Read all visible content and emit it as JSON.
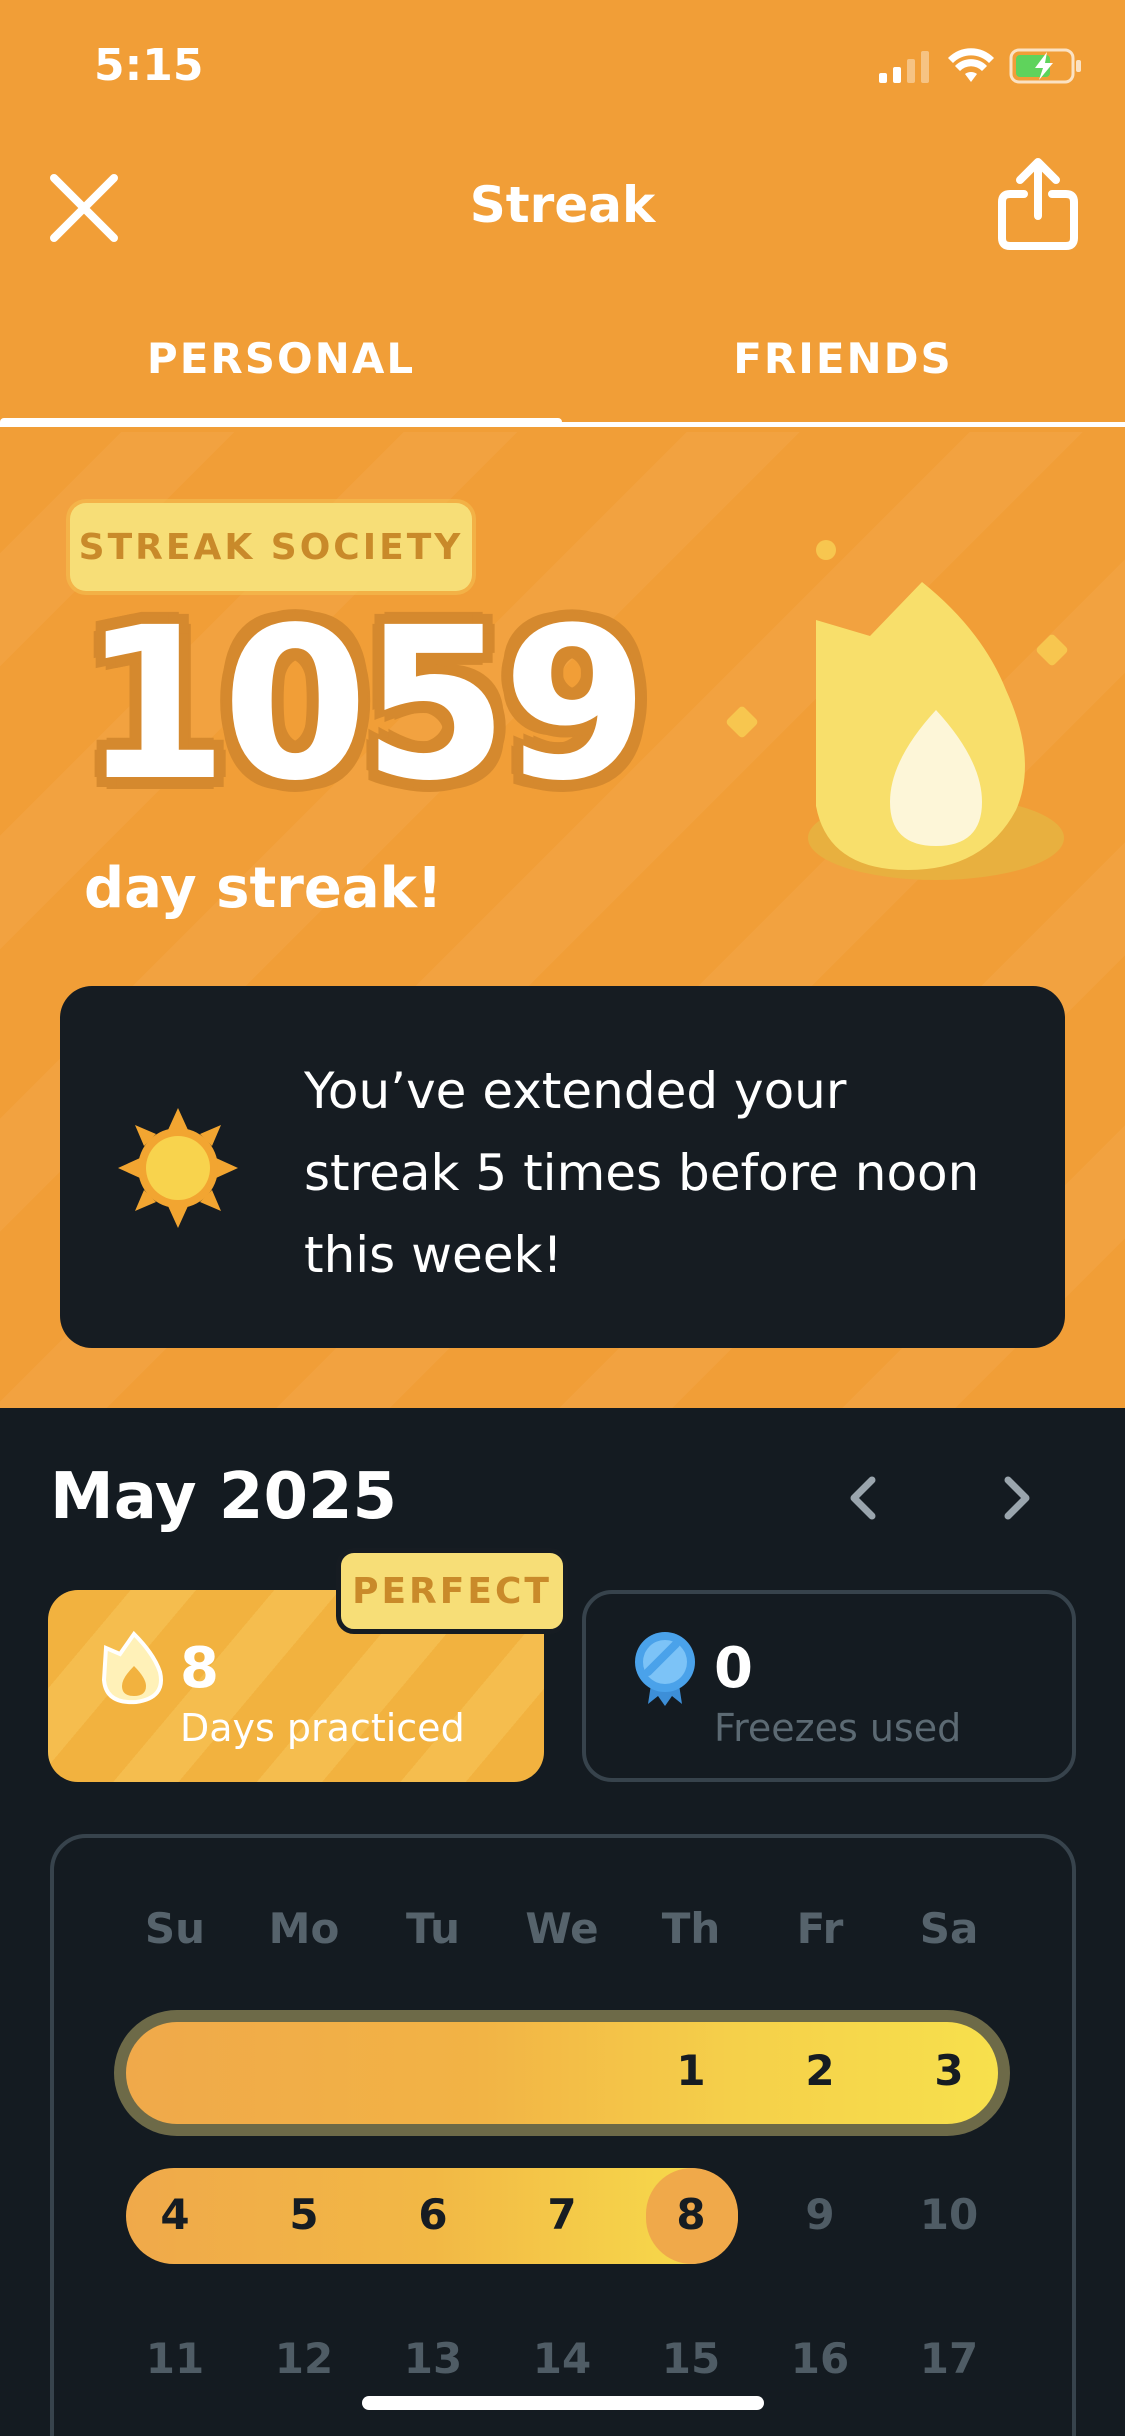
{
  "status_bar": {
    "time": "5:15"
  },
  "header": {
    "title": "Streak"
  },
  "tabs": [
    {
      "label": "PERSONAL",
      "active": true
    },
    {
      "label": "FRIENDS",
      "active": false
    }
  ],
  "hero": {
    "badge": "STREAK SOCIETY",
    "count": "1059",
    "label": "day streak!"
  },
  "message": {
    "lines": [
      "You’ve extended your",
      "streak 5 times before noon",
      "this week!"
    ]
  },
  "calendar": {
    "month": "May 2025",
    "practiced": {
      "badge": "PERFECT",
      "value": "8",
      "label": "Days practiced"
    },
    "freezes": {
      "value": "0",
      "label": "Freezes used"
    },
    "weekdays": [
      "Su",
      "Mo",
      "Tu",
      "We",
      "Th",
      "Fr",
      "Sa"
    ],
    "week1": [
      "",
      "",
      "",
      "",
      "1",
      "2",
      "3"
    ],
    "week2": [
      "4",
      "5",
      "6",
      "7",
      "8",
      "9",
      "10"
    ],
    "week3": [
      "11",
      "12",
      "13",
      "14",
      "15",
      "16",
      "17"
    ]
  },
  "colors": {
    "accent_orange": "#f19e37",
    "dark_bg": "#141b21",
    "badge_yellow": "#f7de77",
    "freeze_blue": "#5ab0f0"
  }
}
